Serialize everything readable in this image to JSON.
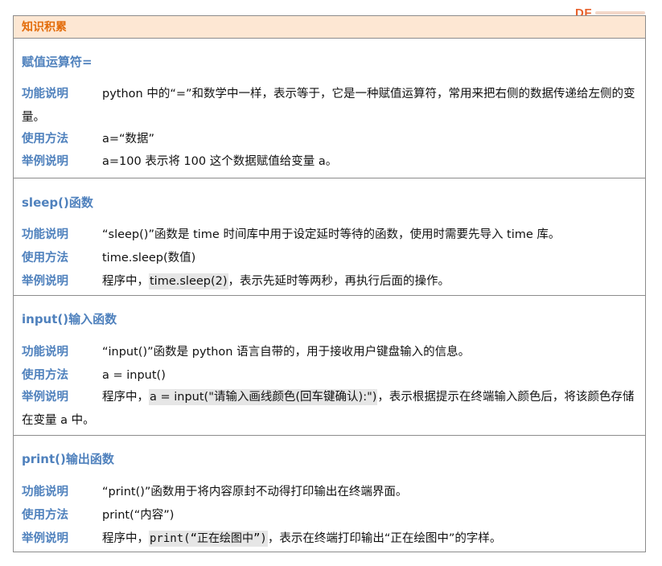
{
  "logo": {
    "text": "DF"
  },
  "header": {
    "title": "知识积累"
  },
  "labels": {
    "function": "功能说明",
    "usage": "使用方法",
    "example": "举例说明"
  },
  "sections": [
    {
      "title": "赋值运算符=",
      "function_text": "python 中的“=”和数学中一样，表示等于，它是一种赋值运算符，常用来把右侧的数据传递给左侧的变量。",
      "usage_text": "a=“数据”",
      "example_text": "a=100 表示将 100 这个数据赋值给变量 a。"
    },
    {
      "title": "sleep()函数",
      "function_text": "“sleep()”函数是 time 时间库中用于设定延时等待的函数，使用时需要先导入 time 库。",
      "usage_text": "time.sleep(数值)",
      "example_prefix": "程序中，",
      "example_code": "time.sleep(2)",
      "example_suffix": "，表示先延时等两秒，再执行后面的操作。"
    },
    {
      "title": "input()输入函数",
      "function_text": "“input()”函数是 python 语言自带的，用于接收用户键盘输入的信息。",
      "usage_text": "a = input()",
      "example_prefix": "程序中，",
      "example_code": "a = input(\"请输入画线颜色(回车键确认):\")",
      "example_suffix": "，表示根据提示在终端输入颜色后，将该颜色存储在变量 a 中。"
    },
    {
      "title": "print()输出函数",
      "function_text": "“print()”函数用于将内容原封不动得打印输出在终端界面。",
      "usage_text": "print(“内容”)",
      "example_prefix": "程序中，",
      "example_code": "print(“正在绘图中”)",
      "example_suffix": "，表示在终端打印输出“正在绘图中”的字样。"
    }
  ]
}
